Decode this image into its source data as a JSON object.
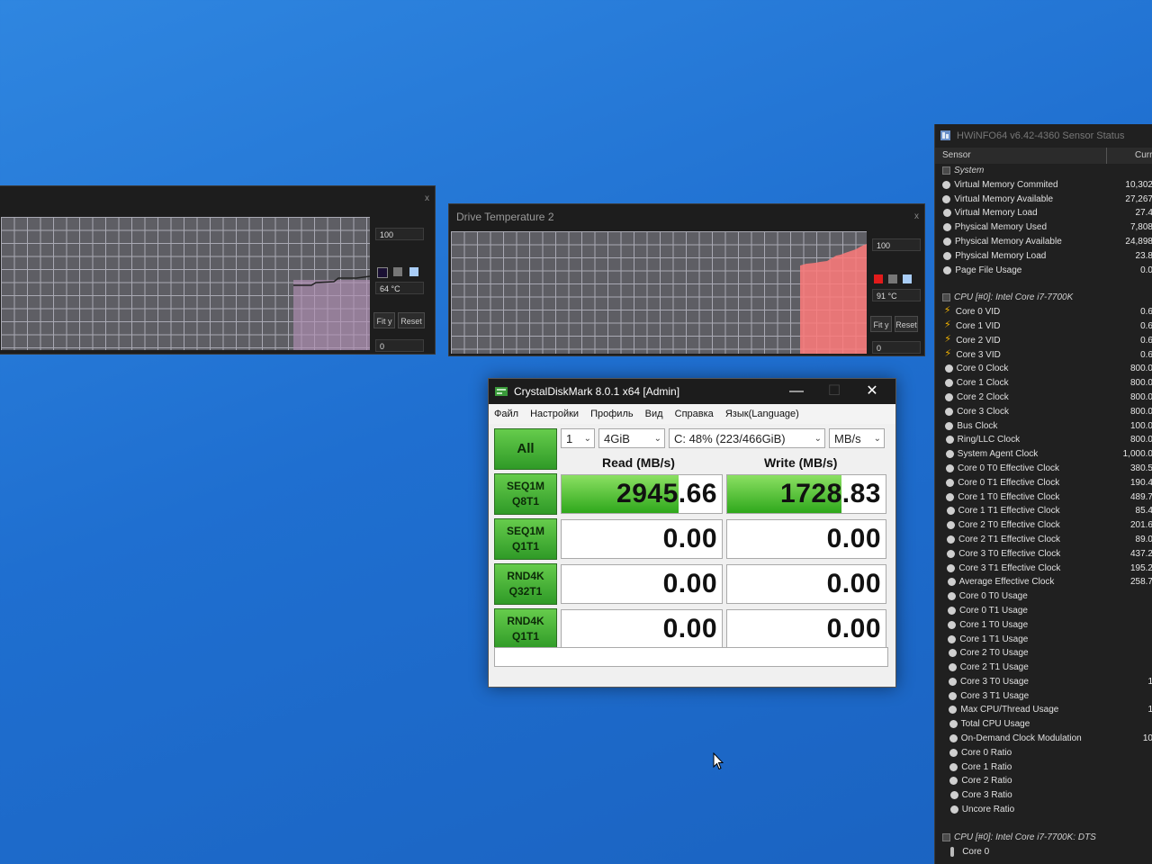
{
  "graph_left": {
    "max": "100",
    "value": "64 °C",
    "min": "0",
    "fit_label": "Fit y",
    "reset_label": "Reset",
    "close": "x",
    "colors": [
      "#1a1033",
      "#777777",
      "#a9cdf7"
    ],
    "series_color": "#b08fb4"
  },
  "graph_right": {
    "title": "Drive Temperature 2",
    "max": "100",
    "value": "91 °C",
    "min": "0",
    "fit_label": "Fit y",
    "reset_label": "Reset",
    "close": "x",
    "colors": [
      "#e21b1b",
      "#777777",
      "#a9cdf7"
    ],
    "series_color": "#ff7a7a"
  },
  "cdm": {
    "title": "CrystalDiskMark 8.0.1 x64 [Admin]",
    "buttons": {
      "minimize": "—",
      "maximize": "☐",
      "close": "✕"
    },
    "menu": [
      "Файл",
      "Настройки",
      "Профиль",
      "Вид",
      "Справка",
      "Язык(Language)"
    ],
    "all_label": "All",
    "count": "1",
    "size": "4GiB",
    "drive": "C: 48% (223/466GiB)",
    "unit": "MB/s",
    "read_header": "Read (MB/s)",
    "write_header": "Write (MB/s)",
    "tests": [
      {
        "line1": "SEQ1M",
        "line2": "Q8T1",
        "read": "2945.66",
        "write": "1728.83",
        "read_fill": 0.73,
        "write_fill": 0.72
      },
      {
        "line1": "SEQ1M",
        "line2": "Q1T1",
        "read": "0.00",
        "write": "0.00",
        "read_fill": 0,
        "write_fill": 0
      },
      {
        "line1": "RND4K",
        "line2": "Q32T1",
        "read": "0.00",
        "write": "0.00",
        "read_fill": 0,
        "write_fill": 0
      },
      {
        "line1": "RND4K",
        "line2": "Q1T1",
        "read": "0.00",
        "write": "0.00",
        "read_fill": 0,
        "write_fill": 0
      }
    ]
  },
  "hwinfo": {
    "title": "HWiNFO64 v6.42-4360 Sensor Status",
    "col_sensor": "Sensor",
    "col_current": "Curr",
    "groups": [
      {
        "header": "System",
        "icon": "box",
        "rows": [
          {
            "label": "Virtual Memory Commited",
            "value": "10,302",
            "icon": "dot"
          },
          {
            "label": "Virtual Memory Available",
            "value": "27,267",
            "icon": "dot"
          },
          {
            "label": "Virtual Memory Load",
            "value": "27.4",
            "icon": "dot"
          },
          {
            "label": "Physical Memory Used",
            "value": "7,808",
            "icon": "dot"
          },
          {
            "label": "Physical Memory Available",
            "value": "24,898",
            "icon": "dot"
          },
          {
            "label": "Physical Memory Load",
            "value": "23.8",
            "icon": "dot"
          },
          {
            "label": "Page File Usage",
            "value": "0.0",
            "icon": "dot"
          }
        ]
      },
      {
        "header": "CPU [#0]: Intel Core i7-7700K",
        "icon": "box",
        "rows": [
          {
            "label": "Core 0 VID",
            "value": "0.6",
            "icon": "bolt"
          },
          {
            "label": "Core 1 VID",
            "value": "0.6",
            "icon": "bolt"
          },
          {
            "label": "Core 2 VID",
            "value": "0.6",
            "icon": "bolt"
          },
          {
            "label": "Core 3 VID",
            "value": "0.6",
            "icon": "bolt"
          },
          {
            "label": "Core 0 Clock",
            "value": "800.0",
            "icon": "dot"
          },
          {
            "label": "Core 1 Clock",
            "value": "800.0",
            "icon": "dot"
          },
          {
            "label": "Core 2 Clock",
            "value": "800.0",
            "icon": "dot"
          },
          {
            "label": "Core 3 Clock",
            "value": "800.0",
            "icon": "dot"
          },
          {
            "label": "Bus Clock",
            "value": "100.0",
            "icon": "dot"
          },
          {
            "label": "Ring/LLC Clock",
            "value": "800.0",
            "icon": "dot"
          },
          {
            "label": "System Agent Clock",
            "value": "1,000.0",
            "icon": "dot"
          },
          {
            "label": "Core 0 T0 Effective Clock",
            "value": "380.5",
            "icon": "dot"
          },
          {
            "label": "Core 0 T1 Effective Clock",
            "value": "190.4",
            "icon": "dot"
          },
          {
            "label": "Core 1 T0 Effective Clock",
            "value": "489.7",
            "icon": "dot"
          },
          {
            "label": "Core 1 T1 Effective Clock",
            "value": "85.4",
            "icon": "dot"
          },
          {
            "label": "Core 2 T0 Effective Clock",
            "value": "201.6",
            "icon": "dot"
          },
          {
            "label": "Core 2 T1 Effective Clock",
            "value": "89.0",
            "icon": "dot"
          },
          {
            "label": "Core 3 T0 Effective Clock",
            "value": "437.2",
            "icon": "dot"
          },
          {
            "label": "Core 3 T1 Effective Clock",
            "value": "195.2",
            "icon": "dot"
          },
          {
            "label": "Average Effective Clock",
            "value": "258.7",
            "icon": "dot"
          },
          {
            "label": "Core 0 T0 Usage",
            "value": "",
            "icon": "dot"
          },
          {
            "label": "Core 0 T1 Usage",
            "value": "",
            "icon": "dot"
          },
          {
            "label": "Core 1 T0 Usage",
            "value": "",
            "icon": "dot"
          },
          {
            "label": "Core 1 T1 Usage",
            "value": "",
            "icon": "dot"
          },
          {
            "label": "Core 2 T0 Usage",
            "value": "",
            "icon": "dot"
          },
          {
            "label": "Core 2 T1 Usage",
            "value": "",
            "icon": "dot"
          },
          {
            "label": "Core 3 T0 Usage",
            "value": "1",
            "icon": "dot"
          },
          {
            "label": "Core 3 T1 Usage",
            "value": "",
            "icon": "dot"
          },
          {
            "label": "Max CPU/Thread Usage",
            "value": "1",
            "icon": "dot"
          },
          {
            "label": "Total CPU Usage",
            "value": "",
            "icon": "dot"
          },
          {
            "label": "On-Demand Clock Modulation",
            "value": "10",
            "icon": "dot"
          },
          {
            "label": "Core 0 Ratio",
            "value": "",
            "icon": "dot"
          },
          {
            "label": "Core 1 Ratio",
            "value": "",
            "icon": "dot"
          },
          {
            "label": "Core 2 Ratio",
            "value": "",
            "icon": "dot"
          },
          {
            "label": "Core 3 Ratio",
            "value": "",
            "icon": "dot"
          },
          {
            "label": "Uncore Ratio",
            "value": "",
            "icon": "dot"
          }
        ]
      },
      {
        "header": "CPU [#0]: Intel Core i7-7700K: DTS",
        "icon": "box",
        "rows": [
          {
            "label": "Core 0",
            "value": "",
            "icon": "therm"
          }
        ]
      }
    ]
  }
}
